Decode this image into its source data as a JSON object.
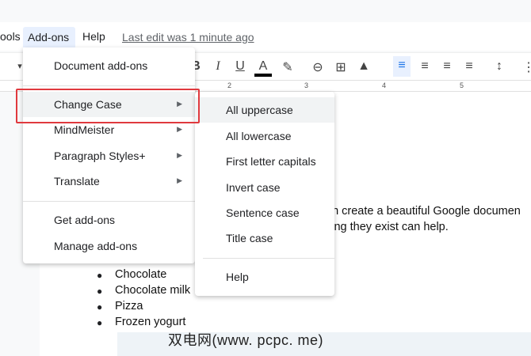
{
  "menubar": {
    "items": [
      "ools",
      "Add-ons",
      "Help"
    ],
    "last_edit": "Last edit was 1 minute ago"
  },
  "toolbar": {
    "icons": [
      "chevron-down-icon",
      "bold-icon",
      "italic-icon",
      "underline-icon",
      "text-color-icon",
      "highlight-icon",
      "link-icon",
      "add-comment-icon",
      "image-icon",
      "align-left-icon",
      "align-center-icon",
      "align-right-icon",
      "justify-icon",
      "line-spacing-icon",
      "numbered-list-icon"
    ],
    "glyphs": [
      "▾",
      "B",
      "I",
      "U",
      "A",
      "✎",
      "⊖",
      "⊞",
      "▲",
      "≡",
      "≡",
      "≡",
      "≡",
      "↕",
      "⋮"
    ]
  },
  "ruler": {
    "marks": [
      "2",
      "3",
      "4",
      "5"
    ]
  },
  "addons_menu": {
    "items": [
      {
        "label": "Document add-ons",
        "submenu": false
      },
      {
        "label": "Change Case",
        "submenu": true,
        "highlighted": true
      },
      {
        "label": "MindMeister",
        "submenu": true
      },
      {
        "label": "Paragraph Styles+",
        "submenu": true
      },
      {
        "label": "Translate",
        "submenu": true
      },
      {
        "label": "Get add-ons",
        "submenu": false
      },
      {
        "label": "Manage add-ons",
        "submenu": false
      }
    ]
  },
  "change_case_menu": {
    "items": [
      "All uppercase",
      "All lowercase",
      "First letter capitals",
      "Invert case",
      "Sentence case",
      "Title case",
      "Help"
    ]
  },
  "document": {
    "lines": [
      "an create a beautiful Google documen",
      "ving they exist can help."
    ],
    "list": [
      "Chocolate",
      "Chocolate milk",
      "Pizza",
      "Frozen yogurt"
    ]
  },
  "watermark": "双电网(www. pcpc. me)",
  "colors": {
    "highlight": "#e8f0fe",
    "annotation": "#e0393e",
    "hover": "#f1f3f4"
  }
}
